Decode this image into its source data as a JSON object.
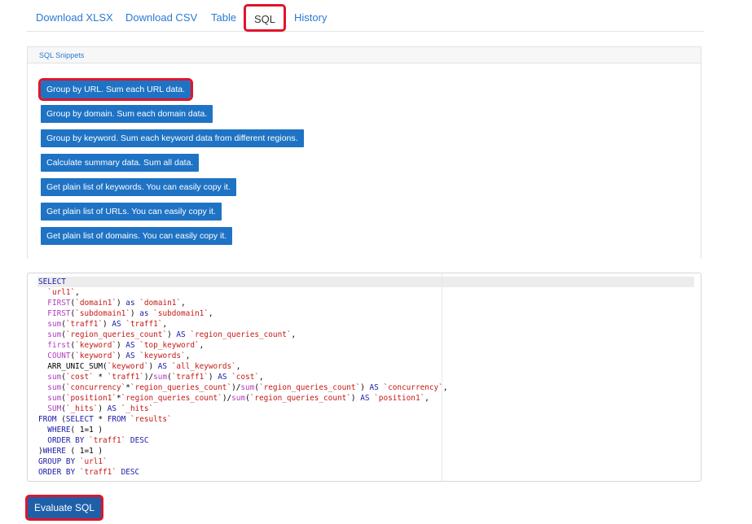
{
  "tabs": [
    {
      "label": "Download XLSX"
    },
    {
      "label": "Download CSV"
    },
    {
      "label": "Table"
    },
    {
      "label": "SQL"
    },
    {
      "label": "History"
    }
  ],
  "active_tab": "SQL",
  "panel": {
    "title": "SQL Snippets",
    "snippets": [
      {
        "label": "Group by URL. Sum each URL data."
      },
      {
        "label": "Group by domain. Sum each domain data."
      },
      {
        "label": "Group by keyword. Sum each keyword data from different regions."
      },
      {
        "label": "Calculate summary data. Sum all data."
      },
      {
        "label": "Get plain list of keywords. You can easily copy it."
      },
      {
        "label": "Get plain list of URLs. You can easily copy it."
      },
      {
        "label": "Get plain list of domains. You can easily copy it."
      }
    ]
  },
  "editor": {
    "lines": [
      [
        [
          "kw",
          "SELECT"
        ]
      ],
      [
        [
          "pl",
          "  "
        ],
        [
          "bt",
          "`url1`"
        ],
        [
          "pl",
          ","
        ]
      ],
      [
        [
          "pl",
          "  "
        ],
        [
          "fn",
          "FIRST"
        ],
        [
          "pl",
          "("
        ],
        [
          "bt",
          "`domain1`"
        ],
        [
          "pl",
          ") "
        ],
        [
          "kw",
          "as"
        ],
        [
          "pl",
          " "
        ],
        [
          "bt",
          "`domain1`"
        ],
        [
          "pl",
          ","
        ]
      ],
      [
        [
          "pl",
          "  "
        ],
        [
          "fn",
          "FIRST"
        ],
        [
          "pl",
          "("
        ],
        [
          "bt",
          "`subdomain1`"
        ],
        [
          "pl",
          ") "
        ],
        [
          "kw",
          "as"
        ],
        [
          "pl",
          " "
        ],
        [
          "bt",
          "`subdomain1`"
        ],
        [
          "pl",
          ","
        ]
      ],
      [
        [
          "pl",
          "  "
        ],
        [
          "fn",
          "sum"
        ],
        [
          "pl",
          "("
        ],
        [
          "bt",
          "`traff1`"
        ],
        [
          "pl",
          ") "
        ],
        [
          "kw",
          "AS"
        ],
        [
          "pl",
          " "
        ],
        [
          "bt",
          "`traff1`"
        ],
        [
          "pl",
          ","
        ]
      ],
      [
        [
          "pl",
          "  "
        ],
        [
          "fn",
          "sum"
        ],
        [
          "pl",
          "("
        ],
        [
          "bt",
          "`region_queries_count`"
        ],
        [
          "pl",
          ") "
        ],
        [
          "kw",
          "AS"
        ],
        [
          "pl",
          " "
        ],
        [
          "bt",
          "`region_queries_count`"
        ],
        [
          "pl",
          ","
        ]
      ],
      [
        [
          "pl",
          "  "
        ],
        [
          "fn",
          "first"
        ],
        [
          "pl",
          "("
        ],
        [
          "bt",
          "`keyword`"
        ],
        [
          "pl",
          ") "
        ],
        [
          "kw",
          "AS"
        ],
        [
          "pl",
          " "
        ],
        [
          "bt",
          "`top_keyword`"
        ],
        [
          "pl",
          ","
        ]
      ],
      [
        [
          "pl",
          "  "
        ],
        [
          "fn",
          "COUNT"
        ],
        [
          "pl",
          "("
        ],
        [
          "bt",
          "`keyword`"
        ],
        [
          "pl",
          ") "
        ],
        [
          "kw",
          "AS"
        ],
        [
          "pl",
          " "
        ],
        [
          "bt",
          "`keywords`"
        ],
        [
          "pl",
          ","
        ]
      ],
      [
        [
          "pl",
          "  ARR_UNIC_SUM("
        ],
        [
          "bt",
          "`keyword`"
        ],
        [
          "pl",
          ") "
        ],
        [
          "kw",
          "AS"
        ],
        [
          "pl",
          " "
        ],
        [
          "bt",
          "`all_keywords`"
        ],
        [
          "pl",
          ","
        ]
      ],
      [
        [
          "pl",
          "  "
        ],
        [
          "fn",
          "sum"
        ],
        [
          "pl",
          "("
        ],
        [
          "bt",
          "`cost`"
        ],
        [
          "pl",
          " * "
        ],
        [
          "bt",
          "`traff1`"
        ],
        [
          "pl",
          ")/"
        ],
        [
          "fn",
          "sum"
        ],
        [
          "pl",
          "("
        ],
        [
          "bt",
          "`traff1`"
        ],
        [
          "pl",
          ") "
        ],
        [
          "kw",
          "AS"
        ],
        [
          "pl",
          " "
        ],
        [
          "bt",
          "`cost`"
        ],
        [
          "pl",
          ","
        ]
      ],
      [
        [
          "pl",
          "  "
        ],
        [
          "fn",
          "sum"
        ],
        [
          "pl",
          "("
        ],
        [
          "bt",
          "`concurrency`"
        ],
        [
          "pl",
          "*"
        ],
        [
          "bt",
          "`region_queries_count`"
        ],
        [
          "pl",
          ")/"
        ],
        [
          "fn",
          "sum"
        ],
        [
          "pl",
          "("
        ],
        [
          "bt",
          "`region_queries_count`"
        ],
        [
          "pl",
          ") "
        ],
        [
          "kw",
          "AS"
        ],
        [
          "pl",
          " "
        ],
        [
          "bt",
          "`concurrency`"
        ],
        [
          "pl",
          ","
        ]
      ],
      [
        [
          "pl",
          "  "
        ],
        [
          "fn",
          "sum"
        ],
        [
          "pl",
          "("
        ],
        [
          "bt",
          "`position1`"
        ],
        [
          "pl",
          "*"
        ],
        [
          "bt",
          "`region_queries_count`"
        ],
        [
          "pl",
          ")/"
        ],
        [
          "fn",
          "sum"
        ],
        [
          "pl",
          "("
        ],
        [
          "bt",
          "`region_queries_count`"
        ],
        [
          "pl",
          ") "
        ],
        [
          "kw",
          "AS"
        ],
        [
          "pl",
          " "
        ],
        [
          "bt",
          "`position1`"
        ],
        [
          "pl",
          ","
        ]
      ],
      [
        [
          "pl",
          "  "
        ],
        [
          "fn",
          "SUM"
        ],
        [
          "pl",
          "("
        ],
        [
          "bt",
          "`_hits`"
        ],
        [
          "pl",
          ") "
        ],
        [
          "kw",
          "AS"
        ],
        [
          "pl",
          " "
        ],
        [
          "bt",
          "`_hits`"
        ]
      ],
      [
        [
          "kw",
          "FROM"
        ],
        [
          "pl",
          " ("
        ],
        [
          "kw",
          "SELECT"
        ],
        [
          "pl",
          " * "
        ],
        [
          "kw",
          "FROM"
        ],
        [
          "pl",
          " "
        ],
        [
          "bt",
          "`results`"
        ]
      ],
      [
        [
          "pl",
          "  "
        ],
        [
          "kw",
          "WHERE"
        ],
        [
          "pl",
          "( 1=1 )"
        ]
      ],
      [
        [
          "pl",
          "  "
        ],
        [
          "kw",
          "ORDER BY"
        ],
        [
          "pl",
          " "
        ],
        [
          "bt",
          "`traff1`"
        ],
        [
          "pl",
          " "
        ],
        [
          "kw",
          "DESC"
        ]
      ],
      [
        [
          "pl",
          ")"
        ],
        [
          "kw",
          "WHERE"
        ],
        [
          "pl",
          " ( 1=1 )"
        ]
      ],
      [
        [
          "kw",
          "GROUP BY"
        ],
        [
          "pl",
          " "
        ],
        [
          "bt",
          "`url1`"
        ]
      ],
      [
        [
          "kw",
          "ORDER BY"
        ],
        [
          "pl",
          " "
        ],
        [
          "bt",
          "`traff1`"
        ],
        [
          "pl",
          " "
        ],
        [
          "kw",
          "DESC"
        ]
      ]
    ]
  },
  "evaluate_label": "Evaluate SQL"
}
